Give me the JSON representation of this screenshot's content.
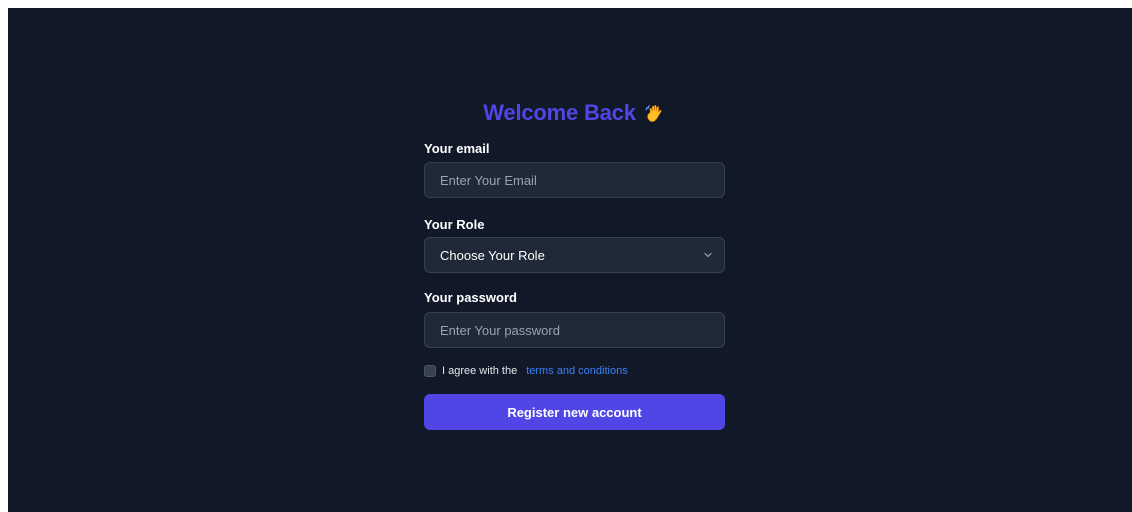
{
  "title": {
    "text": "Welcome Back",
    "icon": "waving-hand-icon"
  },
  "email": {
    "label": "Your email",
    "placeholder": "Enter Your Email",
    "value": ""
  },
  "role": {
    "label": "Your Role",
    "selected": "Choose Your Role",
    "icon": "chevron-down-icon"
  },
  "password": {
    "label": "Your password",
    "placeholder": "Enter Your password",
    "value": ""
  },
  "agreement": {
    "text": "I agree with the",
    "link_text": "terms and conditions",
    "checked": false
  },
  "submit": {
    "label": "Register new account"
  },
  "colors": {
    "background": "#111827",
    "accent": "#4f46e5",
    "link": "#3b82f6",
    "field_background": "#1f2937",
    "field_border": "#374151"
  }
}
